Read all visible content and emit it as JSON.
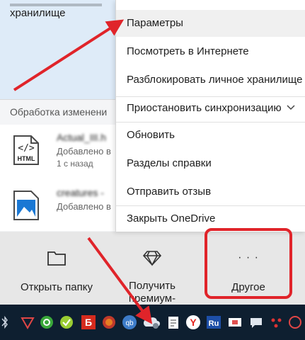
{
  "panel": {
    "top_text": "хранилище",
    "processing_label": "Обработка изменени"
  },
  "files": [
    {
      "icon_label": "HTML",
      "name": "Actual_III.h",
      "status": "Добавлено в",
      "time": "1 с назад"
    },
    {
      "icon_label": "",
      "name": "creatures -",
      "status": "Добавлено в",
      "time": ""
    }
  ],
  "menu": {
    "items": [
      {
        "label": "Параметры"
      },
      {
        "label": "Посмотреть в Интернете"
      },
      {
        "label": "Разблокировать личное хранилище"
      },
      {
        "label": "Приостановить синхронизацию"
      },
      {
        "label": "Обновить"
      },
      {
        "label": "Разделы справки"
      },
      {
        "label": "Отправить отзыв"
      },
      {
        "label": "Закрыть OneDrive"
      }
    ]
  },
  "bottom_bar": {
    "open_folder": "Открыть папку",
    "premium_line1": "Получить",
    "premium_line2": "премиум-",
    "more": "Другое",
    "more_glyph": "· · ·"
  },
  "taskbar": {
    "icons": [
      "bluetooth-icon",
      "app-red-icon",
      "network-icon",
      "check-icon",
      "b-icon",
      "fire-icon",
      "qb-icon",
      "onedrive-cloud-icon",
      "notepad-icon",
      "yandex-icon",
      "ru-language-icon",
      "display-icon",
      "chat-icon",
      "more-icon"
    ]
  },
  "colors": {
    "accent_red": "#e0242a",
    "taskbar": "#0e1f30",
    "top_area": "#deebf8"
  }
}
